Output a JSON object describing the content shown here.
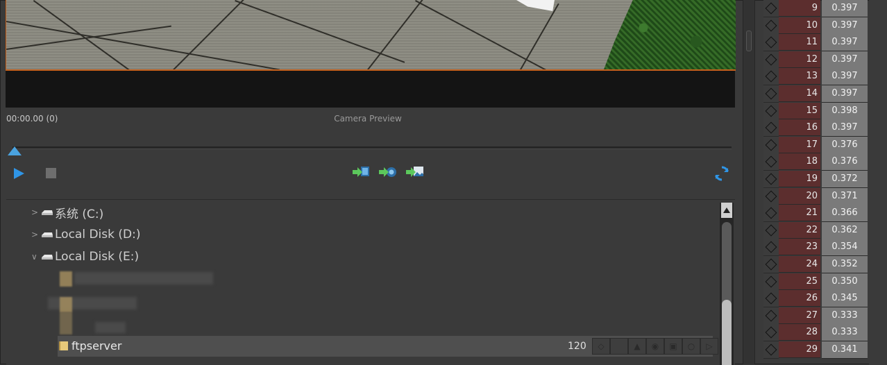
{
  "preview": {
    "timecode": "00:00.00 (0)",
    "title": "Camera Preview"
  },
  "transport": {
    "play_icon": "play-icon",
    "stop_icon": "stop-icon",
    "tools": [
      "import-frame-icon",
      "import-camera-icon",
      "import-image-icon"
    ],
    "sync_icon": "refresh-icon",
    "accent": "#2f95e6"
  },
  "tree": {
    "drives": [
      {
        "label": "系统 (C:)",
        "expanded": false
      },
      {
        "label": "Local Disk (D:)",
        "expanded": false
      },
      {
        "label": "Local Disk (E:)",
        "expanded": true
      }
    ],
    "selected": {
      "label": "ftpserver",
      "count": "120"
    }
  },
  "keyframes": {
    "rows": [
      {
        "frame": "9",
        "value": "0.397"
      },
      {
        "frame": "10",
        "value": "0.397"
      },
      {
        "frame": "11",
        "value": "0.397"
      },
      {
        "frame": "12",
        "value": "0.397"
      },
      {
        "frame": "13",
        "value": "0.397"
      },
      {
        "frame": "14",
        "value": "0.397"
      },
      {
        "frame": "15",
        "value": "0.398"
      },
      {
        "frame": "16",
        "value": "0.397"
      },
      {
        "frame": "17",
        "value": "0.376"
      },
      {
        "frame": "18",
        "value": "0.376"
      },
      {
        "frame": "19",
        "value": "0.372"
      },
      {
        "frame": "20",
        "value": "0.371"
      },
      {
        "frame": "21",
        "value": "0.366"
      },
      {
        "frame": "22",
        "value": "0.362"
      },
      {
        "frame": "23",
        "value": "0.354"
      },
      {
        "frame": "24",
        "value": "0.352"
      },
      {
        "frame": "25",
        "value": "0.350"
      },
      {
        "frame": "26",
        "value": "0.345"
      },
      {
        "frame": "27",
        "value": "0.333"
      },
      {
        "frame": "28",
        "value": "0.333"
      },
      {
        "frame": "29",
        "value": "0.341"
      }
    ],
    "frame_color": "#5c2e2e",
    "value_color": "#7a7a7a"
  }
}
